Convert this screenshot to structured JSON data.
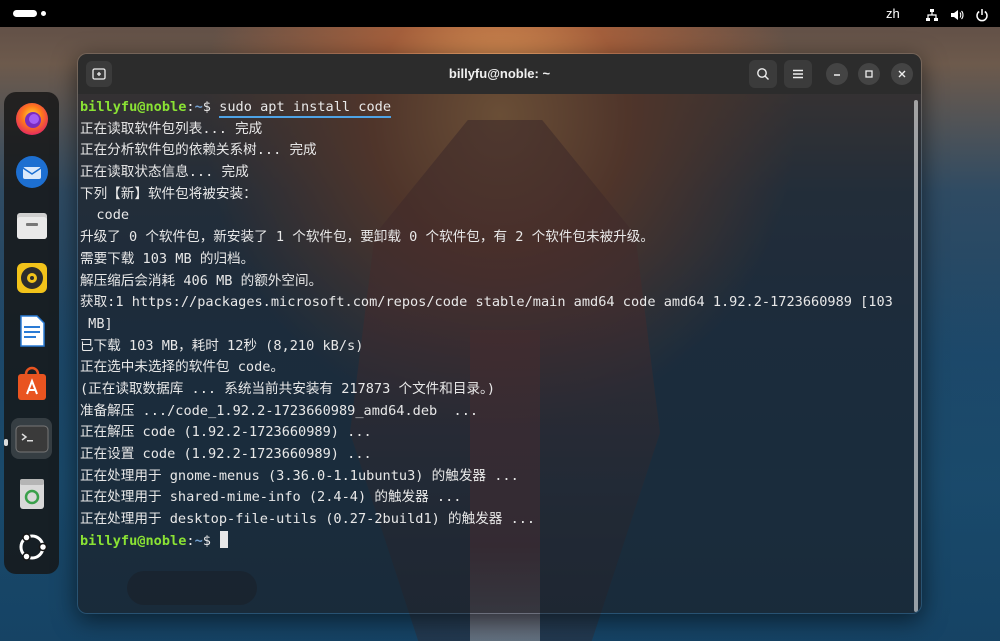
{
  "topbar": {
    "lang": "zh",
    "icons": [
      "network-icon",
      "volume-icon",
      "power-icon"
    ]
  },
  "dock": {
    "apps": [
      {
        "name": "firefox-icon",
        "label": "Firefox"
      },
      {
        "name": "thunderbird-icon",
        "label": "Thunderbird"
      },
      {
        "name": "files-icon",
        "label": "Files"
      },
      {
        "name": "rhythmbox-icon",
        "label": "Rhythmbox"
      },
      {
        "name": "writer-icon",
        "label": "Writer"
      },
      {
        "name": "app-center-icon",
        "label": "App Center"
      },
      {
        "name": "terminal-icon",
        "label": "Terminal"
      },
      {
        "name": "trash-icon",
        "label": "Trash"
      },
      {
        "name": "ubuntu-icon",
        "label": "Show Apps"
      }
    ]
  },
  "window": {
    "title": "billyfu@noble: ~"
  },
  "terminal": {
    "prompt_user": "billyfu@noble",
    "prompt_sep": ":",
    "prompt_path": "~",
    "prompt_end": "$ ",
    "command": "sudo apt install code",
    "output": [
      "正在读取软件包列表... 完成",
      "正在分析软件包的依赖关系树... 完成",
      "正在读取状态信息... 完成",
      "下列【新】软件包将被安装：",
      "  code",
      "升级了 0 个软件包，新安装了 1 个软件包，要卸载 0 个软件包，有 2 个软件包未被升级。",
      "需要下载 103 MB 的归档。",
      "解压缩后会消耗 406 MB 的额外空间。",
      "获取:1 https://packages.microsoft.com/repos/code stable/main amd64 code amd64 1.92.2-1723660989 [103",
      " MB]",
      "已下载 103 MB，耗时 12秒 (8,210 kB/s)",
      "正在选中未选择的软件包 code。",
      "(正在读取数据库 ... 系统当前共安装有 217873 个文件和目录。)",
      "准备解压 .../code_1.92.2-1723660989_amd64.deb  ...",
      "正在解压 code (1.92.2-1723660989) ...",
      "正在设置 code (1.92.2-1723660989) ...",
      "正在处理用于 gnome-menus (3.36.0-1.1ubuntu3) 的触发器 ...",
      "正在处理用于 shared-mime-info (2.4-4) 的触发器 ...",
      "正在处理用于 desktop-file-utils (0.27-2build1) 的触发器 ..."
    ]
  },
  "colors": {
    "prompt_user": "#8ae234",
    "prompt_path": "#729fcf",
    "accent": "#4ea3e6"
  }
}
